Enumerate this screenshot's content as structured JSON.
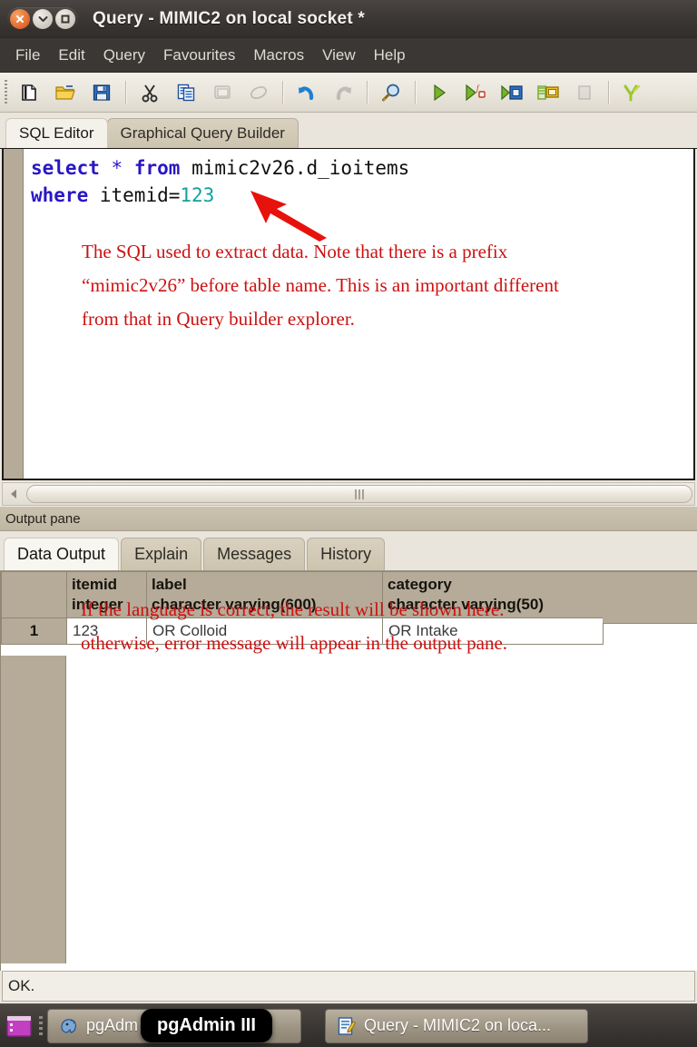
{
  "window": {
    "title": "Query - MIMIC2 on local socket *",
    "buttons": {
      "close": "close-icon",
      "minimize": "minimize-icon",
      "maximize": "maximize-icon"
    }
  },
  "menubar": {
    "items": [
      "File",
      "Edit",
      "Query",
      "Favourites",
      "Macros",
      "View",
      "Help"
    ]
  },
  "toolbar": {
    "icons": [
      {
        "name": "new-file-icon",
        "enabled": true
      },
      {
        "name": "open-file-icon",
        "enabled": true
      },
      {
        "name": "save-file-icon",
        "enabled": true
      },
      {
        "name": "cut-icon",
        "enabled": true
      },
      {
        "name": "copy-icon",
        "enabled": true
      },
      {
        "name": "paste-icon",
        "enabled": false
      },
      {
        "name": "clear-window-icon",
        "enabled": false
      },
      {
        "name": "undo-icon",
        "enabled": true
      },
      {
        "name": "redo-icon",
        "enabled": false
      },
      {
        "name": "find-replace-icon",
        "enabled": true
      },
      {
        "name": "execute-query-icon",
        "enabled": true
      },
      {
        "name": "explain-query-icon",
        "enabled": true
      },
      {
        "name": "execute-to-file-icon",
        "enabled": true
      },
      {
        "name": "explain-analyze-icon",
        "enabled": true
      },
      {
        "name": "cancel-query-icon",
        "enabled": false
      },
      {
        "name": "macros-icon",
        "enabled": true
      }
    ]
  },
  "editor_tabs": [
    {
      "label": "SQL Editor",
      "active": true
    },
    {
      "label": "Graphical Query Builder",
      "active": false
    }
  ],
  "sql": {
    "line1": {
      "kw1": "select",
      "op": "*",
      "kw2": "from",
      "ident": "mimic2v26.d_ioitems"
    },
    "line2": {
      "kw": "where",
      "ident": "itemid=",
      "num": "123"
    }
  },
  "annotations": {
    "editor": "The SQL used to extract data. Note that there is a prefix\n“mimic2v26” before table name. This is an important different\nfrom that in Query builder explorer.",
    "editor_lines": [
      "The SQL used to extract data. Note that there is a prefix",
      "“mimic2v26” before table name. This is an important different",
      "from that in Query builder explorer."
    ],
    "grid_lines": [
      "If the language is correct, the result will be shown here.",
      "otherwise, error message will appear in the output pane."
    ],
    "color": "#cc1111",
    "arrow": "red-arrow-annotation"
  },
  "output_pane": {
    "label": "Output pane",
    "tabs": [
      {
        "label": "Data Output",
        "active": true
      },
      {
        "label": "Explain",
        "active": false
      },
      {
        "label": "Messages",
        "active": false
      },
      {
        "label": "History",
        "active": false
      }
    ]
  },
  "grid": {
    "columns": [
      {
        "name": "itemid",
        "type": "integer"
      },
      {
        "name": "label",
        "type": "character varying(600)"
      },
      {
        "name": "category",
        "type": "character varying(50)"
      }
    ],
    "rows": [
      {
        "num": "1",
        "itemid": "123",
        "label": "OR Colloid",
        "category": "OR Intake"
      }
    ]
  },
  "statusbar": {
    "text": "OK."
  },
  "taskbar": {
    "items": [
      {
        "label": "pgAdm",
        "icon": "pgadmin-elephant-icon"
      },
      {
        "label": "Query - MIMIC2 on loca...",
        "icon": "query-editor-icon"
      }
    ],
    "tooltip": "pgAdmin III",
    "launcher_icon": "window-list-icon"
  },
  "scrollbar": {
    "left_arrow": "scroll-left-icon",
    "thumb": "scroll-thumb"
  }
}
